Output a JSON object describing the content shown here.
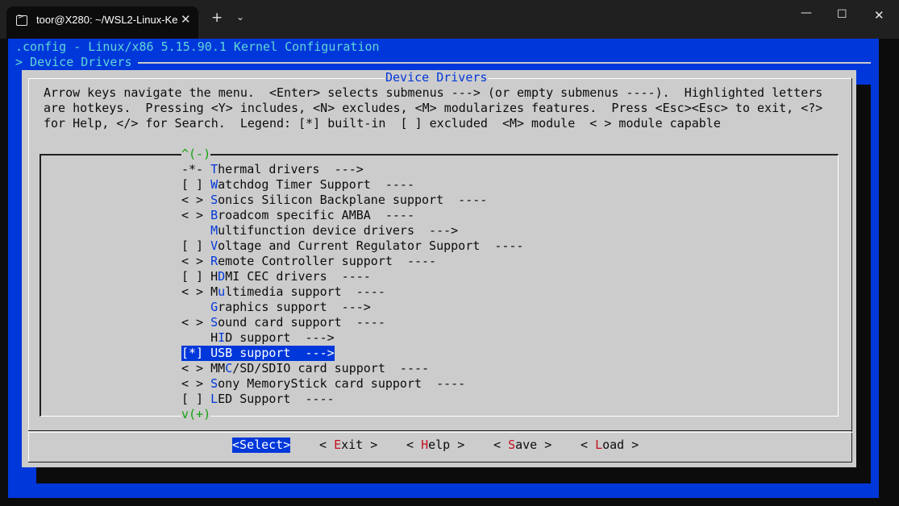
{
  "window": {
    "tab_title": "toor@X280: ~/WSL2-Linux-Ke",
    "tab_close_glyph": "✕",
    "new_tab_glyph": "+",
    "dropdown_glyph": "⌄",
    "minimize_glyph": "—",
    "maximize_glyph": "☐",
    "close_glyph": "✕"
  },
  "header": {
    "config_title": ".config - Linux/x86 5.15.90.1 Kernel Configuration",
    "breadcrumb": "> Device Drivers "
  },
  "dialog": {
    "title": "Device Drivers",
    "help_lines": [
      "Arrow keys navigate the menu.  <Enter> selects submenus ---> (or empty submenus ----).  Highlighted letters",
      "are hotkeys.  Pressing <Y> includes, <N> excludes, <M> modularizes features.  Press <Esc><Esc> to exit, <?>",
      "for Help, </> for Search.  Legend: [*] built-in  [ ] excluded  <M> module  < > module capable"
    ],
    "scroll_up": "^(-)",
    "scroll_down": "v(+)",
    "items": [
      {
        "prefix": "-*- ",
        "pre": "",
        "hotkey": "T",
        "rest": "hermal drivers  --->"
      },
      {
        "prefix": "[ ] ",
        "pre": "",
        "hotkey": "W",
        "rest": "atchdog Timer Support  ----"
      },
      {
        "prefix": "< > ",
        "pre": "",
        "hotkey": "S",
        "rest": "onics Silicon Backplane support  ----"
      },
      {
        "prefix": "< > ",
        "pre": "",
        "hotkey": "B",
        "rest": "roadcom specific AMBA  ----"
      },
      {
        "prefix": "    ",
        "pre": "",
        "hotkey": "M",
        "rest": "ultifunction device drivers  --->"
      },
      {
        "prefix": "[ ] ",
        "pre": "",
        "hotkey": "V",
        "rest": "oltage and Current Regulator Support  ----"
      },
      {
        "prefix": "< > ",
        "pre": "",
        "hotkey": "R",
        "rest": "emote Controller support  ----"
      },
      {
        "prefix": "[ ] ",
        "pre": "H",
        "hotkey": "D",
        "rest": "MI CEC drivers  ----"
      },
      {
        "prefix": "< > ",
        "pre": "M",
        "hotkey": "u",
        "rest": "ltimedia support  ----"
      },
      {
        "prefix": "    ",
        "pre": "",
        "hotkey": "G",
        "rest": "raphics support  --->"
      },
      {
        "prefix": "< > ",
        "pre": "",
        "hotkey": "S",
        "rest": "ound card support  ----"
      },
      {
        "prefix": "    ",
        "pre": "H",
        "hotkey": "I",
        "rest": "D support  --->"
      },
      {
        "prefix": "[*] ",
        "pre": "",
        "hotkey": "U",
        "rest": "SB support  --->"
      },
      {
        "prefix": "< > ",
        "pre": "MM",
        "hotkey": "C",
        "rest": "/SD/SDIO card support  ----"
      },
      {
        "prefix": "< > ",
        "pre": "",
        "hotkey": "S",
        "rest": "ony MemoryStick card support  ----"
      },
      {
        "prefix": "[ ] ",
        "pre": "",
        "hotkey": "L",
        "rest": "ED Support  ----"
      }
    ],
    "selected_index": 12,
    "buttons": [
      {
        "open": "<",
        "hotkey": "S",
        "rest": "elect",
        "close": ">"
      },
      {
        "open": "< ",
        "hotkey": "E",
        "rest": "xit",
        "close": " >"
      },
      {
        "open": "< ",
        "hotkey": "H",
        "rest": "elp",
        "close": " >"
      },
      {
        "open": "< ",
        "hotkey": "S",
        "rest": "ave",
        "close": " >"
      },
      {
        "open": "< ",
        "hotkey": "L",
        "rest": "oad",
        "close": " >"
      }
    ]
  },
  "colors": {
    "terminal_background": "#0c0c0c",
    "menuconfig_blue": "#0037da",
    "dialog_gray": "#cccccc",
    "hotkey_red": "#c50f1f",
    "scroll_green": "#13a10e",
    "header_cyan": "#61d6d6"
  }
}
